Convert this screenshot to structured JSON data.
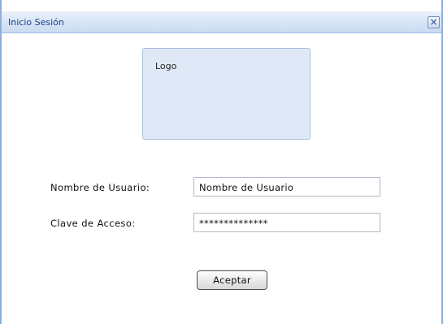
{
  "window": {
    "title": "Inicio Sesión",
    "close_glyph": "×",
    "close_icon": "close-icon"
  },
  "logo": {
    "text": "Logo"
  },
  "form": {
    "username_label": "Nombre de Usuario:",
    "username_value": "Nombre de Usuario",
    "password_label": "Clave de Acceso:",
    "password_value": "**************",
    "accept_label": "Aceptar"
  },
  "colors": {
    "title_text": "#15428b",
    "titlebar_bg": "#d7e4f6",
    "border": "#99bbe8",
    "logo_bg": "#dfe8f6"
  }
}
